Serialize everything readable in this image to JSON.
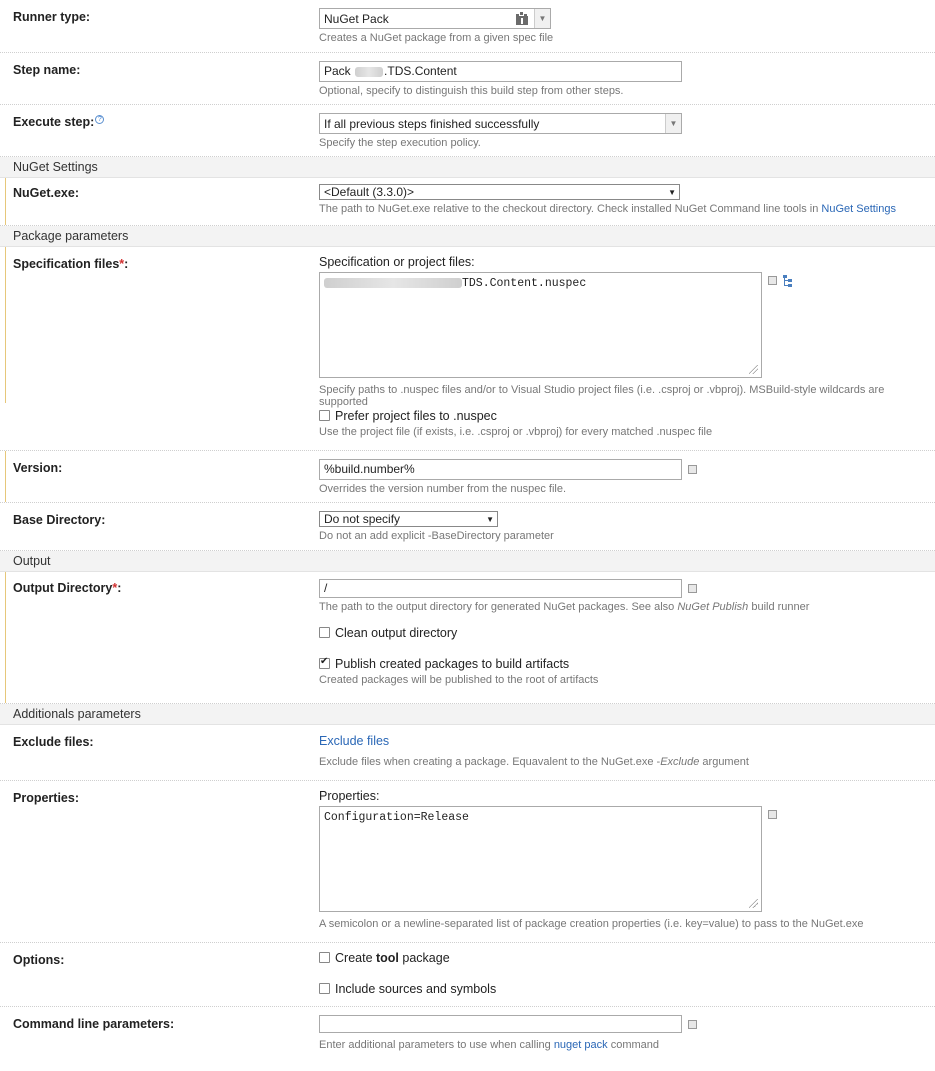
{
  "runner": {
    "label": "Runner type:",
    "value": "NuGet Pack",
    "hint": "Creates a NuGet package from a given spec file"
  },
  "step_name": {
    "label": "Step name:",
    "value_prefix": "Pack",
    "value_suffix": ".TDS.Content",
    "hint": "Optional, specify to distinguish this build step from other steps."
  },
  "execute_step": {
    "label": "Execute step:",
    "help": "?",
    "value": "If all previous steps finished successfully",
    "hint": "Specify the step execution policy."
  },
  "sections": {
    "nuget_settings": "NuGet Settings",
    "package_parameters": "Package parameters",
    "output": "Output",
    "additional": "Additionals parameters"
  },
  "nuget_exe": {
    "label": "NuGet.exe:",
    "value": "<Default (3.3.0)>",
    "hint_text": "The path to NuGet.exe relative to the checkout directory. Check installed NuGet Command line tools in ",
    "hint_link": "NuGet Settings"
  },
  "spec_files": {
    "label": "Specification files",
    "star": "*",
    "colon": ":",
    "sublabel": "Specification or project files:",
    "value_suffix": "TDS.Content.nuspec",
    "hint": "Specify paths to .nuspec files and/or to Visual Studio project files (i.e. .csproj or .vbproj). MSBuild-style wildcards are supported"
  },
  "prefer_project": {
    "label": "Prefer project files to .nuspec",
    "checked": false,
    "hint": "Use the project file (if exists, i.e. .csproj or .vbproj) for every matched .nuspec file"
  },
  "version": {
    "label": "Version:",
    "value": "%build.number%",
    "hint": "Overrides the version number from the nuspec file."
  },
  "base_dir": {
    "label": "Base Directory:",
    "value": "Do not specify",
    "hint": "Do not an add explicit -BaseDirectory parameter"
  },
  "output_dir": {
    "label": "Output Directory",
    "star": "*",
    "colon": ":",
    "value": "/",
    "hint_text": "The path to the output directory for generated NuGet packages. See also ",
    "hint_italic": "NuGet Publish",
    "hint_tail": " build runner"
  },
  "clean_output": {
    "label": "Clean output directory",
    "checked": false
  },
  "publish_packages": {
    "label": "Publish created packages to build artifacts",
    "checked": true,
    "hint": "Created packages will be published to the root of artifacts"
  },
  "exclude_files": {
    "label": "Exclude files:",
    "link": "Exclude files",
    "hint_text": "Exclude files when creating a package. Equavalent to the NuGet.exe -",
    "hint_italic": "Exclude",
    "hint_tail": " argument"
  },
  "properties": {
    "label": "Properties:",
    "sublabel": "Properties:",
    "value": "Configuration=Release",
    "hint": "A semicolon or a newline-separated list of package creation properties (i.e. key=value) to pass to the NuGet.exe"
  },
  "options": {
    "label": "Options:",
    "tool_pre": "Create ",
    "tool_bold": "tool",
    "tool_post": " package",
    "tool_checked": false,
    "symbols_label": "Include sources and symbols",
    "symbols_checked": false
  },
  "cmdline": {
    "label": "Command line parameters:",
    "value": "",
    "hint_text": "Enter additional parameters to use when calling ",
    "hint_link": "nuget pack",
    "hint_tail": " command"
  },
  "colors": {
    "link": "#2a67b6",
    "required_bar": "#e6c77a",
    "section_bg": "#f3f3f3",
    "required_star": "#d12f2f"
  },
  "icons": {
    "runner_icon": "package-icon",
    "tree_icon": "tree-picker-icon",
    "param_icon": "parameter-picker-icon"
  }
}
